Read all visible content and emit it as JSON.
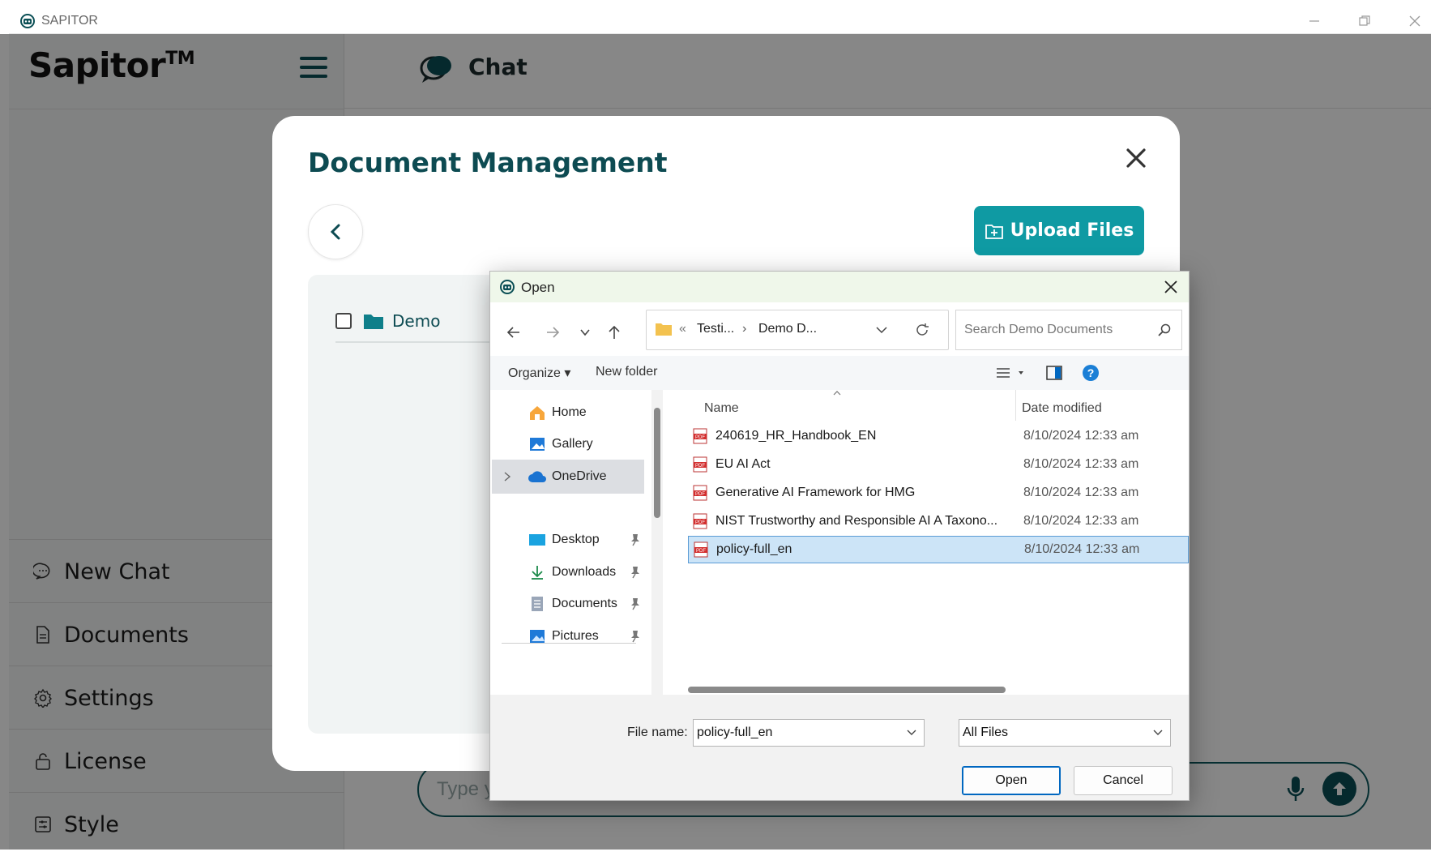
{
  "window": {
    "title": "SAPITOR"
  },
  "brand": {
    "name": "Sapitor",
    "tm": "TM"
  },
  "header": {
    "title": "Chat"
  },
  "sidebar": {
    "items": [
      {
        "label": "New Chat",
        "icon": "chat-bubble-icon"
      },
      {
        "label": "Documents",
        "icon": "document-icon"
      },
      {
        "label": "Settings",
        "icon": "gear-icon"
      },
      {
        "label": "License",
        "icon": "lock-icon"
      },
      {
        "label": "Style",
        "icon": "style-icon"
      }
    ]
  },
  "chat_input": {
    "placeholder": "Type y"
  },
  "modal": {
    "title": "Document Management",
    "upload_label": "Upload Files",
    "folder": {
      "name": "Demo"
    }
  },
  "dialog": {
    "title": "Open",
    "breadcrumb": {
      "chevrons": "«",
      "seg1": "Testi...",
      "sep": "›",
      "seg2": "Demo D..."
    },
    "search_placeholder": "Search Demo Documents",
    "organize": "Organize",
    "new_folder": "New folder",
    "nav": [
      {
        "label": "Home",
        "icon": "home-icon"
      },
      {
        "label": "Gallery",
        "icon": "gallery-icon"
      },
      {
        "label": "OneDrive",
        "icon": "cloud-icon"
      },
      {
        "label": "Desktop",
        "icon": "desktop-icon"
      },
      {
        "label": "Downloads",
        "icon": "download-icon"
      },
      {
        "label": "Documents",
        "icon": "documents-icon"
      },
      {
        "label": "Pictures",
        "icon": "pictures-icon"
      }
    ],
    "columns": {
      "name": "Name",
      "date": "Date modified"
    },
    "files": [
      {
        "name": "240619_HR_Handbook_EN",
        "date": "8/10/2024 12:33 am"
      },
      {
        "name": "EU AI Act",
        "date": "8/10/2024 12:33 am"
      },
      {
        "name": "Generative AI Framework for HMG",
        "date": "8/10/2024 12:33 am"
      },
      {
        "name": "NIST Trustworthy and Responsible AI A Taxono...",
        "date": "8/10/2024 12:33 am"
      },
      {
        "name": "policy-full_en",
        "date": "8/10/2024 12:33 am"
      }
    ],
    "selected_file_index": 4,
    "file_name_label": "File name:",
    "file_name_value": "policy-full_en",
    "file_type": "All Files",
    "open_label": "Open",
    "cancel_label": "Cancel"
  },
  "colors": {
    "accent": "#0f9aa3",
    "dark_teal": "#0d4b52",
    "selection": "#cce4f7"
  }
}
